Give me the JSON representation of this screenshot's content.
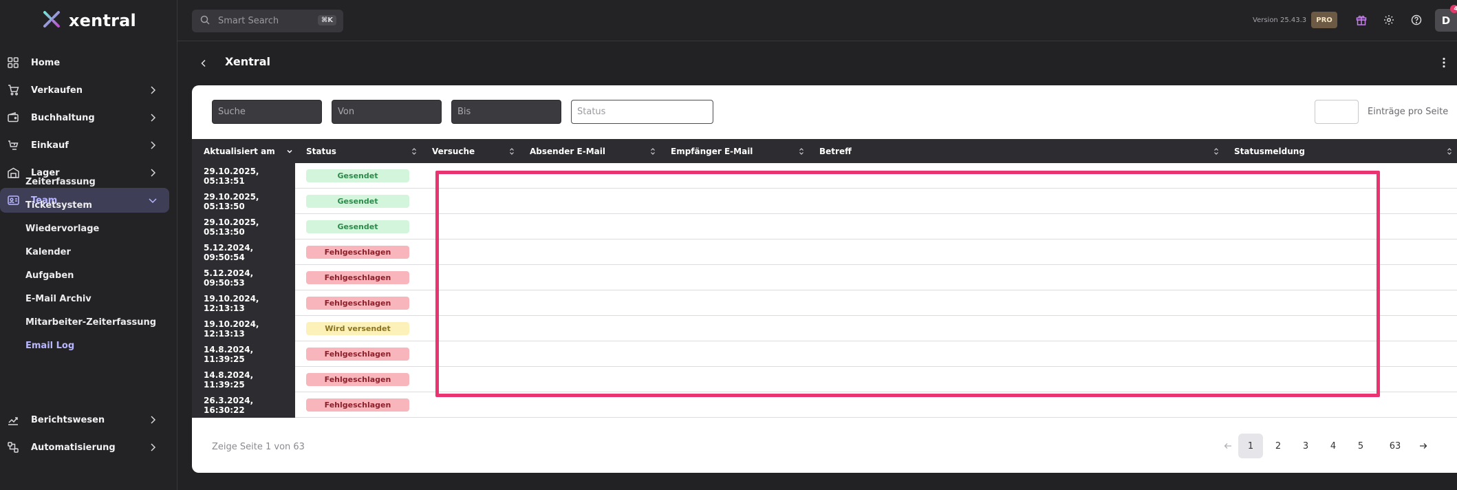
{
  "app": {
    "name": "xentral",
    "version": "Version 25.43.3",
    "plan_badge": "PRO",
    "avatar_initial": "D",
    "notification_count": "4",
    "search_placeholder": "Smart Search",
    "search_shortcut": "⌘K"
  },
  "sidebar": {
    "items": [
      {
        "label": "Home",
        "icon": "home-grid-icon",
        "expandable": false
      },
      {
        "label": "Verkaufen",
        "icon": "cart-icon",
        "expandable": true
      },
      {
        "label": "Buchhaltung",
        "icon": "wallet-icon",
        "expandable": true
      },
      {
        "label": "Einkauf",
        "icon": "purchase-icon",
        "expandable": true
      },
      {
        "label": "Lager",
        "icon": "warehouse-icon",
        "expandable": true
      },
      {
        "label": "Team",
        "icon": "team-icon",
        "expandable": true,
        "active": true
      },
      {
        "label": "Berichtswesen",
        "icon": "chart-icon",
        "expandable": true
      },
      {
        "label": "Automatisierung",
        "icon": "automation-icon",
        "expandable": true
      }
    ],
    "team_subitems": [
      "Zeiterfassung",
      "Ticketsystem",
      "Wiedervorlage",
      "Kalender",
      "Aufgaben",
      "E-Mail Archiv",
      "Mitarbeiter-Zeiterfassung",
      "Email Log"
    ],
    "active_subitem": "Email Log"
  },
  "page": {
    "title": "Xentral"
  },
  "filters": {
    "search": "Suche",
    "from": "Von",
    "to": "Bis",
    "status": "Status",
    "per_page_value": "",
    "per_page_label": "Einträge pro Seite"
  },
  "table": {
    "columns": [
      "Aktualisiert am",
      "Status",
      "Versuche",
      "Absender E-Mail",
      "Empfänger E-Mail",
      "Betreff",
      "Statusmeldung"
    ],
    "rows": [
      {
        "updated": "29.10.2025, 05:13:51",
        "status": "Gesendet",
        "kind": "sent"
      },
      {
        "updated": "29.10.2025, 05:13:50",
        "status": "Gesendet",
        "kind": "sent"
      },
      {
        "updated": "29.10.2025, 05:13:50",
        "status": "Gesendet",
        "kind": "sent"
      },
      {
        "updated": "5.12.2024, 09:50:54",
        "status": "Fehlgeschlagen",
        "kind": "fail"
      },
      {
        "updated": "5.12.2024, 09:50:53",
        "status": "Fehlgeschlagen",
        "kind": "fail"
      },
      {
        "updated": "19.10.2024, 12:13:13",
        "status": "Fehlgeschlagen",
        "kind": "fail"
      },
      {
        "updated": "19.10.2024, 12:13:13",
        "status": "Wird versendet",
        "kind": "pending"
      },
      {
        "updated": "14.8.2024, 11:39:25",
        "status": "Fehlgeschlagen",
        "kind": "fail"
      },
      {
        "updated": "14.8.2024, 11:39:25",
        "status": "Fehlgeschlagen",
        "kind": "fail"
      },
      {
        "updated": "26.3.2024, 16:30:22",
        "status": "Fehlgeschlagen",
        "kind": "fail"
      }
    ]
  },
  "pagination": {
    "info": "Zeige Seite 1 von 63",
    "prev": "←",
    "next": "→",
    "pages": [
      "1",
      "2",
      "3",
      "4",
      "5",
      "63"
    ],
    "current": "1"
  },
  "colors": {
    "highlight": "#ea3472",
    "active_nav": "#3e3f57",
    "accent_text": "#b8b6ff"
  }
}
